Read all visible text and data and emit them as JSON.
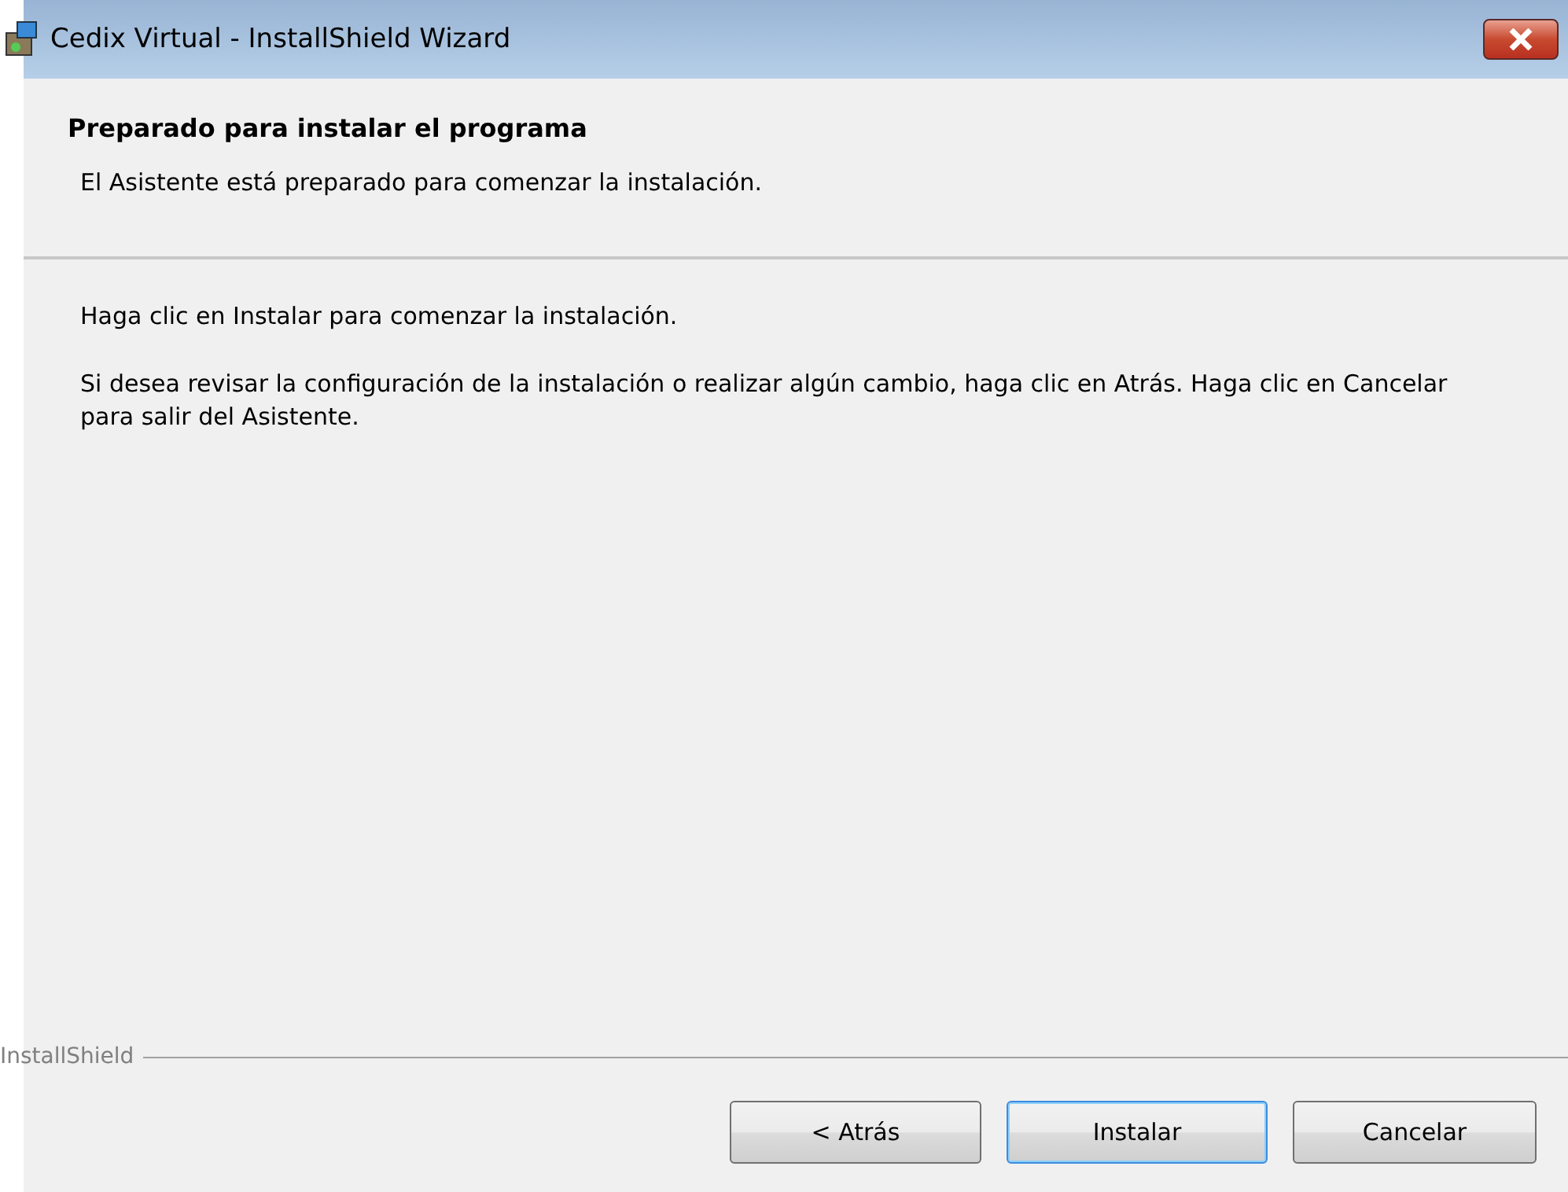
{
  "window": {
    "title": "Cedix Virtual - InstallShield Wizard"
  },
  "header": {
    "title": "Preparado para instalar el programa",
    "subtitle": "El Asistente está preparado para comenzar la instalación."
  },
  "body": [
    "Haga clic en Instalar para comenzar la instalación.",
    "Si desea revisar la configuración de la instalación o realizar algún cambio, haga clic en Atrás. Haga clic en Cancelar para salir del Asistente."
  ],
  "brand": "InstallShield",
  "buttons": [
    {
      "label": "< Atrás",
      "default": false
    },
    {
      "label": "Instalar",
      "default": true
    },
    {
      "label": "Cancelar",
      "default": false
    }
  ]
}
